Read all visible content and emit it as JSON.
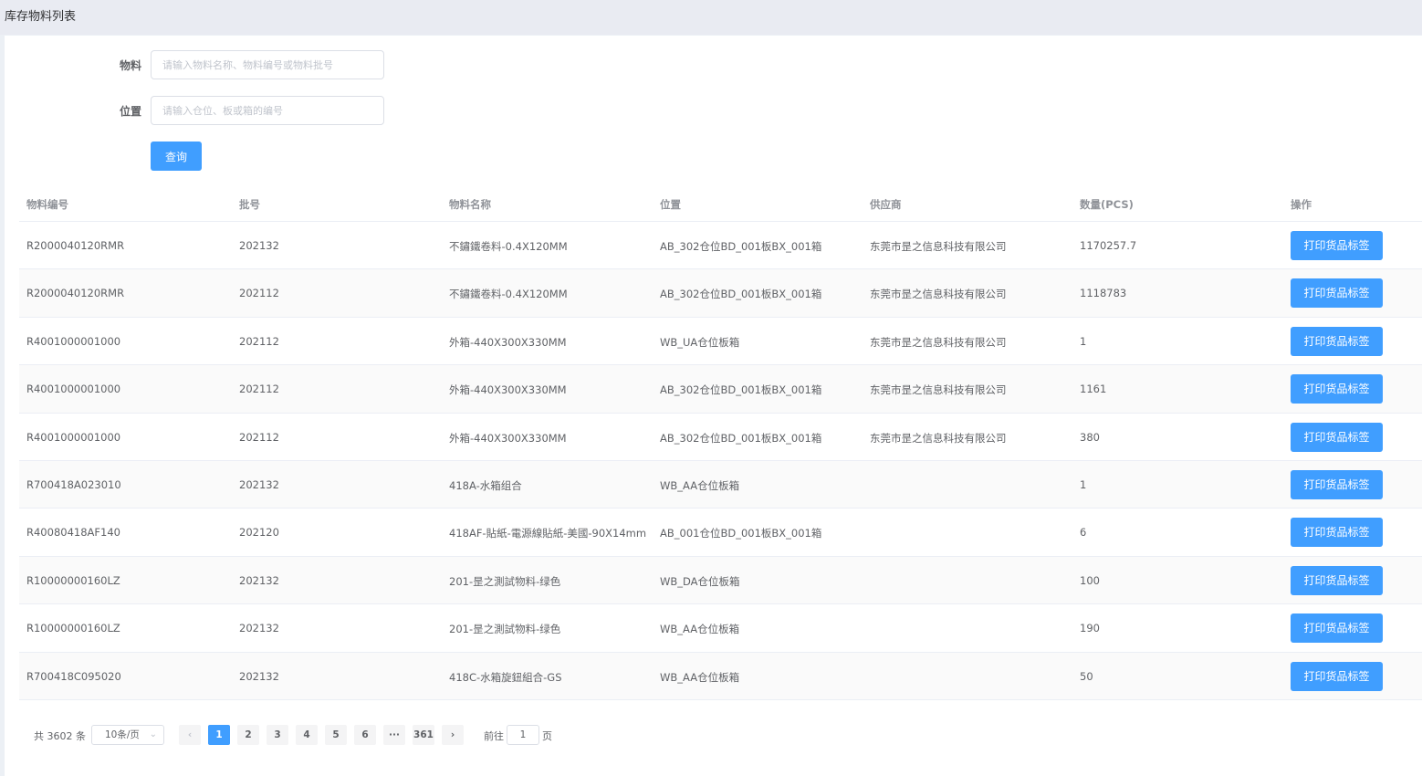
{
  "page": {
    "title": "库存物料列表"
  },
  "form": {
    "material_label": "物料",
    "material_placeholder": "请输入物料名称、物料编号或物料批号",
    "location_label": "位置",
    "location_placeholder": "请输入仓位、板或箱的编号",
    "query_button": "查询"
  },
  "table": {
    "headers": [
      "物料编号",
      "批号",
      "物料名称",
      "位置",
      "供应商",
      "数量(PCS)",
      "操作"
    ],
    "action_label": "打印货品标签",
    "rows": [
      [
        "R2000040120RMR",
        "202132",
        "不鏽鐵卷料-0.4X120MM",
        "AB_302仓位BD_001板BX_001箱",
        "东莞市昰之信息科技有限公司",
        "1170257.7"
      ],
      [
        "R2000040120RMR",
        "202112",
        "不鏽鐵卷料-0.4X120MM",
        "AB_302仓位BD_001板BX_001箱",
        "东莞市昰之信息科技有限公司",
        "1118783"
      ],
      [
        "R4001000001000",
        "202112",
        "外箱-440X300X330MM",
        "WB_UA仓位板箱",
        "东莞市昰之信息科技有限公司",
        "1"
      ],
      [
        "R4001000001000",
        "202112",
        "外箱-440X300X330MM",
        "AB_302仓位BD_001板BX_001箱",
        "东莞市昰之信息科技有限公司",
        "1161"
      ],
      [
        "R4001000001000",
        "202112",
        "外箱-440X300X330MM",
        "AB_302仓位BD_001板BX_001箱",
        "东莞市昰之信息科技有限公司",
        "380"
      ],
      [
        "R700418A023010",
        "202132",
        "418A-水箱组合",
        "WB_AA仓位板箱",
        "",
        "1"
      ],
      [
        "R40080418AF140",
        "202120",
        "418AF-貼紙-電源線貼紙-美國-90X14mm",
        "AB_001仓位BD_001板BX_001箱",
        "",
        "6"
      ],
      [
        "R10000000160LZ",
        "202132",
        "201-昰之測試物料-绿色",
        "WB_DA仓位板箱",
        "",
        "100"
      ],
      [
        "R10000000160LZ",
        "202132",
        "201-昰之測試物料-绿色",
        "WB_AA仓位板箱",
        "",
        "190"
      ],
      [
        "R700418C095020",
        "202132",
        "418C-水箱旋鈕組合-GS",
        "WB_AA仓位板箱",
        "",
        "50"
      ]
    ]
  },
  "pagination": {
    "total_text": "共 3602 条",
    "page_size": "10条/页",
    "size_arrow": "⌄",
    "prev": "‹",
    "next": "›",
    "pages": [
      "1",
      "2",
      "3",
      "4",
      "5",
      "6",
      "···",
      "361"
    ],
    "current": "1",
    "goto_label": "前往",
    "goto_value": "1",
    "goto_suffix": "页"
  }
}
